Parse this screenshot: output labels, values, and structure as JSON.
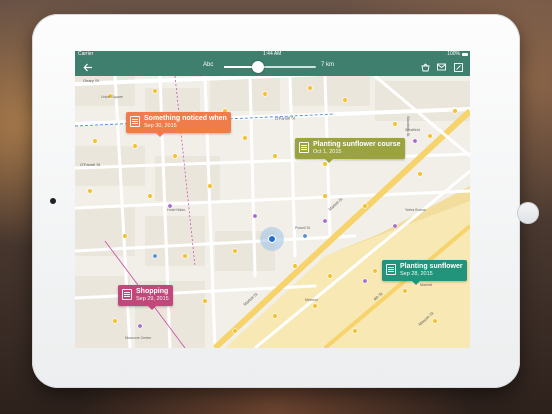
{
  "status": {
    "carrier": "Carrier",
    "time": "1:44 AM",
    "battery": "100%"
  },
  "toolbar": {
    "back_icon": "back-arrow-icon",
    "slider_label_left": "Abc",
    "slider_label_right": "7 km",
    "slider_value_fraction": 0.37,
    "actions": [
      "basket-icon",
      "mail-icon",
      "edit-icon"
    ]
  },
  "notes": [
    {
      "title": "Something noticed when",
      "date": "Sep 30, 2015",
      "color": "#ef7d4b"
    },
    {
      "title": "Planting sunflower course",
      "date": "Oct 1, 2015",
      "color": "#9aa33f"
    },
    {
      "title": "Shopping",
      "date": "Sep 29, 2015",
      "color": "#c0487a"
    },
    {
      "title": "Planting sunflower",
      "date": "Sep 28, 2015",
      "color": "#22947c"
    }
  ],
  "map": {
    "streets": [
      "Geary St",
      "O'Farrell St",
      "O'Farrell St",
      "Ellis St",
      "Powell St",
      "Market St",
      "Mission St",
      "4th St",
      "Stockton St",
      "Mason St",
      "Taylor St",
      "Jones St"
    ],
    "places": [
      "Union Square",
      "Westfield San Francisco Centre",
      "Powell St",
      "Westin St. Francis",
      "Hotel Nikko",
      "Cable Car Turnaround",
      "Yerba Buena Gardens",
      "Metreon",
      "Moscone Center",
      "Four Seasons Hotel",
      "St. Regis",
      "Apple Store",
      "Marriott",
      "Saks Fifth Avenue",
      "Macy's",
      "Hilton"
    ]
  }
}
